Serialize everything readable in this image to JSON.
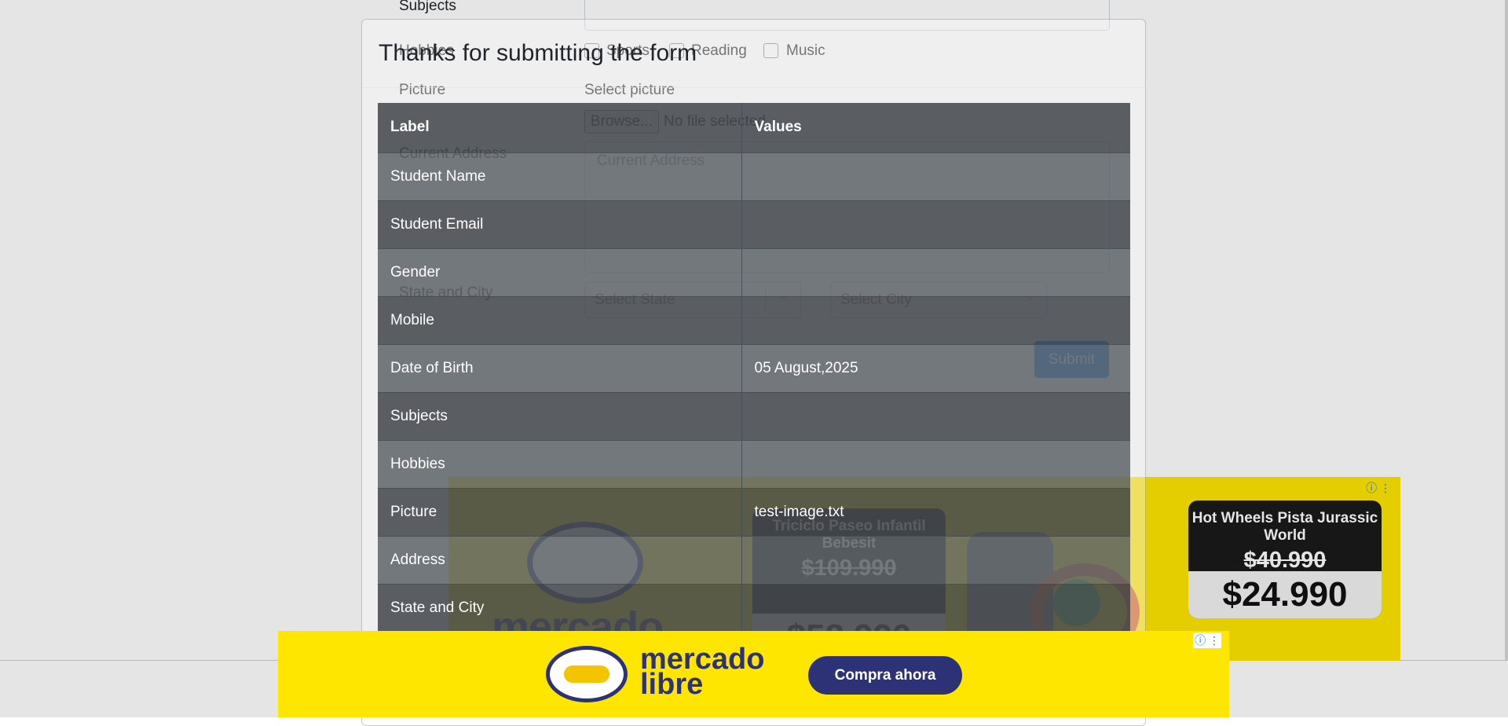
{
  "background_form": {
    "subjects_label": "Subjects",
    "hobbies_label": "Hobbies",
    "hobbies_options": [
      "Sports",
      "Reading",
      "Music"
    ],
    "picture_label": "Picture",
    "picture_hint": "Select picture",
    "browse_button": "Browse...",
    "no_file_text": "No file selected.",
    "address_label": "Current Address",
    "address_placeholder": "Current Address",
    "state_city_label": "State and City",
    "state_placeholder": "Select State",
    "city_placeholder": "Select City",
    "submit_label": "Submit"
  },
  "modal": {
    "title": "Thanks for submitting the form",
    "table": {
      "headers": [
        "Label",
        "Values"
      ],
      "rows": [
        {
          "label": "Student Name",
          "value": ""
        },
        {
          "label": "Student Email",
          "value": ""
        },
        {
          "label": "Gender",
          "value": ""
        },
        {
          "label": "Mobile",
          "value": ""
        },
        {
          "label": "Date of Birth",
          "value": "05 August,2025"
        },
        {
          "label": "Subjects",
          "value": ""
        },
        {
          "label": "Hobbies",
          "value": ""
        },
        {
          "label": "Picture",
          "value": "test-image.txt"
        },
        {
          "label": "Address",
          "value": ""
        },
        {
          "label": "State and City",
          "value": ""
        }
      ]
    }
  },
  "ad_mid": {
    "logo_text": "mercado",
    "card1": {
      "name": "Triciclo Paseo Infantil Bebesit",
      "old_price": "$109.990",
      "new_price": "$58.990"
    },
    "card2": {
      "name": "Hot Wheels Pista Jurassic World",
      "old_price": "$40.990",
      "new_price": "$24.990"
    }
  },
  "ad_bottom": {
    "brand": "mercado\nlibre",
    "cta": "Compra ahora"
  },
  "colors": {
    "ad_yellow": "#ffe600",
    "brand_navy": "#2d3277",
    "table_dark": "#343a40",
    "submit_blue": "#007bff"
  }
}
